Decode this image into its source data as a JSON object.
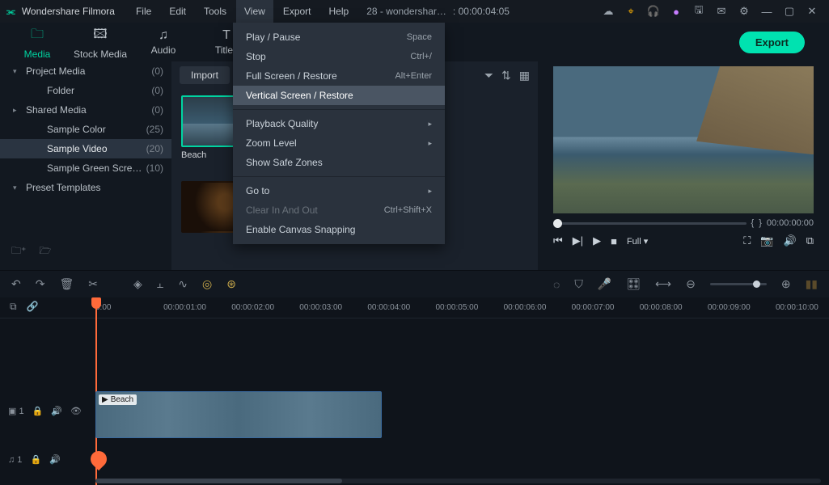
{
  "titlebar": {
    "app_name": "Wondershare Filmora",
    "menus": [
      "File",
      "Edit",
      "Tools",
      "View",
      "Export",
      "Help"
    ],
    "project": "28 - wondershar…",
    "timecode": ": 00:00:04:05"
  },
  "toptabs": [
    "Media",
    "Stock Media",
    "Audio",
    "Titles"
  ],
  "export_label": "Export",
  "sidebar": {
    "items": [
      {
        "label": "Project Media",
        "count": "(0)",
        "arrow": "▾"
      },
      {
        "label": "Folder",
        "count": "(0)",
        "indent": true
      },
      {
        "label": "Shared Media",
        "count": "(0)",
        "arrow": "▸"
      },
      {
        "label": "Sample Color",
        "count": "(25)",
        "indent": true
      },
      {
        "label": "Sample Video",
        "count": "(20)",
        "indent": true,
        "selected": true
      },
      {
        "label": "Sample Green Scre…",
        "count": "(10)",
        "indent": true
      },
      {
        "label": "Preset Templates",
        "count": "",
        "arrow": "▾"
      }
    ]
  },
  "mediabin": {
    "import_label": "Import",
    "clip_name": "Beach"
  },
  "dropdown": {
    "rows": [
      {
        "label": "Play / Pause",
        "accel": "Space"
      },
      {
        "label": "Stop",
        "accel": "Ctrl+/"
      },
      {
        "label": "Full Screen / Restore",
        "accel": "Alt+Enter"
      },
      {
        "label": "Vertical Screen / Restore",
        "accel": "",
        "hover": true
      },
      {
        "sep": true
      },
      {
        "label": "Playback Quality",
        "sub": "▸"
      },
      {
        "label": "Zoom Level",
        "sub": "▸"
      },
      {
        "label": "Show Safe Zones"
      },
      {
        "sep": true
      },
      {
        "label": "Go to",
        "sub": "▸"
      },
      {
        "label": "Clear In And Out",
        "accel": "Ctrl+Shift+X",
        "disabled": true
      },
      {
        "label": "Enable Canvas Snapping"
      }
    ]
  },
  "preview": {
    "mark_in": "{",
    "mark_out": "}",
    "time": "00:00:00:00",
    "fit": "Full ▾"
  },
  "ruler": [
    "0:00",
    "00:00:01:00",
    "00:00:02:00",
    "00:00:03:00",
    "00:00:04:00",
    "00:00:05:00",
    "00:00:06:00",
    "00:00:07:00",
    "00:00:08:00",
    "00:00:09:00",
    "00:00:10:00"
  ],
  "tracks": {
    "video_label": "▣ 1",
    "audio_label": "♫ 1",
    "clip_label": "Beach"
  }
}
